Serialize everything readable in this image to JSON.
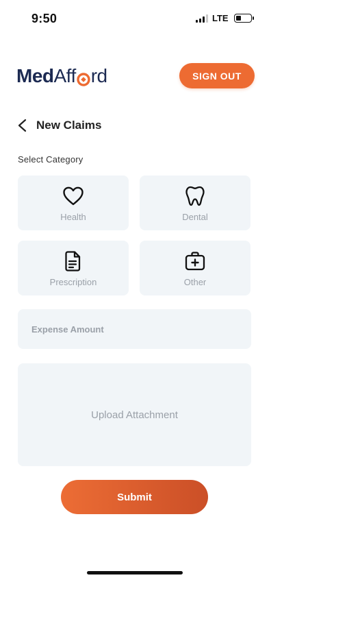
{
  "status_bar": {
    "time": "9:50",
    "network": "LTE",
    "battery_level": 0.4
  },
  "header": {
    "logo_part1": "Med",
    "logo_part2": "Aff",
    "logo_part3": "rd",
    "sign_out_label": "SIGN OUT"
  },
  "page": {
    "title": "New Claims",
    "section_label": "Select Category"
  },
  "categories": [
    {
      "label": "Health",
      "icon": "heart-icon"
    },
    {
      "label": "Dental",
      "icon": "tooth-icon"
    },
    {
      "label": "Prescription",
      "icon": "document-icon"
    },
    {
      "label": "Other",
      "icon": "medical-kit-icon"
    }
  ],
  "form": {
    "amount_placeholder": "Expense Amount",
    "upload_label": "Upload Attachment",
    "submit_label": "Submit"
  },
  "colors": {
    "accent": "#ed6b32",
    "brand_navy": "#1c2a52",
    "tile_bg": "#f1f5f8",
    "placeholder": "#9aa0a8"
  }
}
